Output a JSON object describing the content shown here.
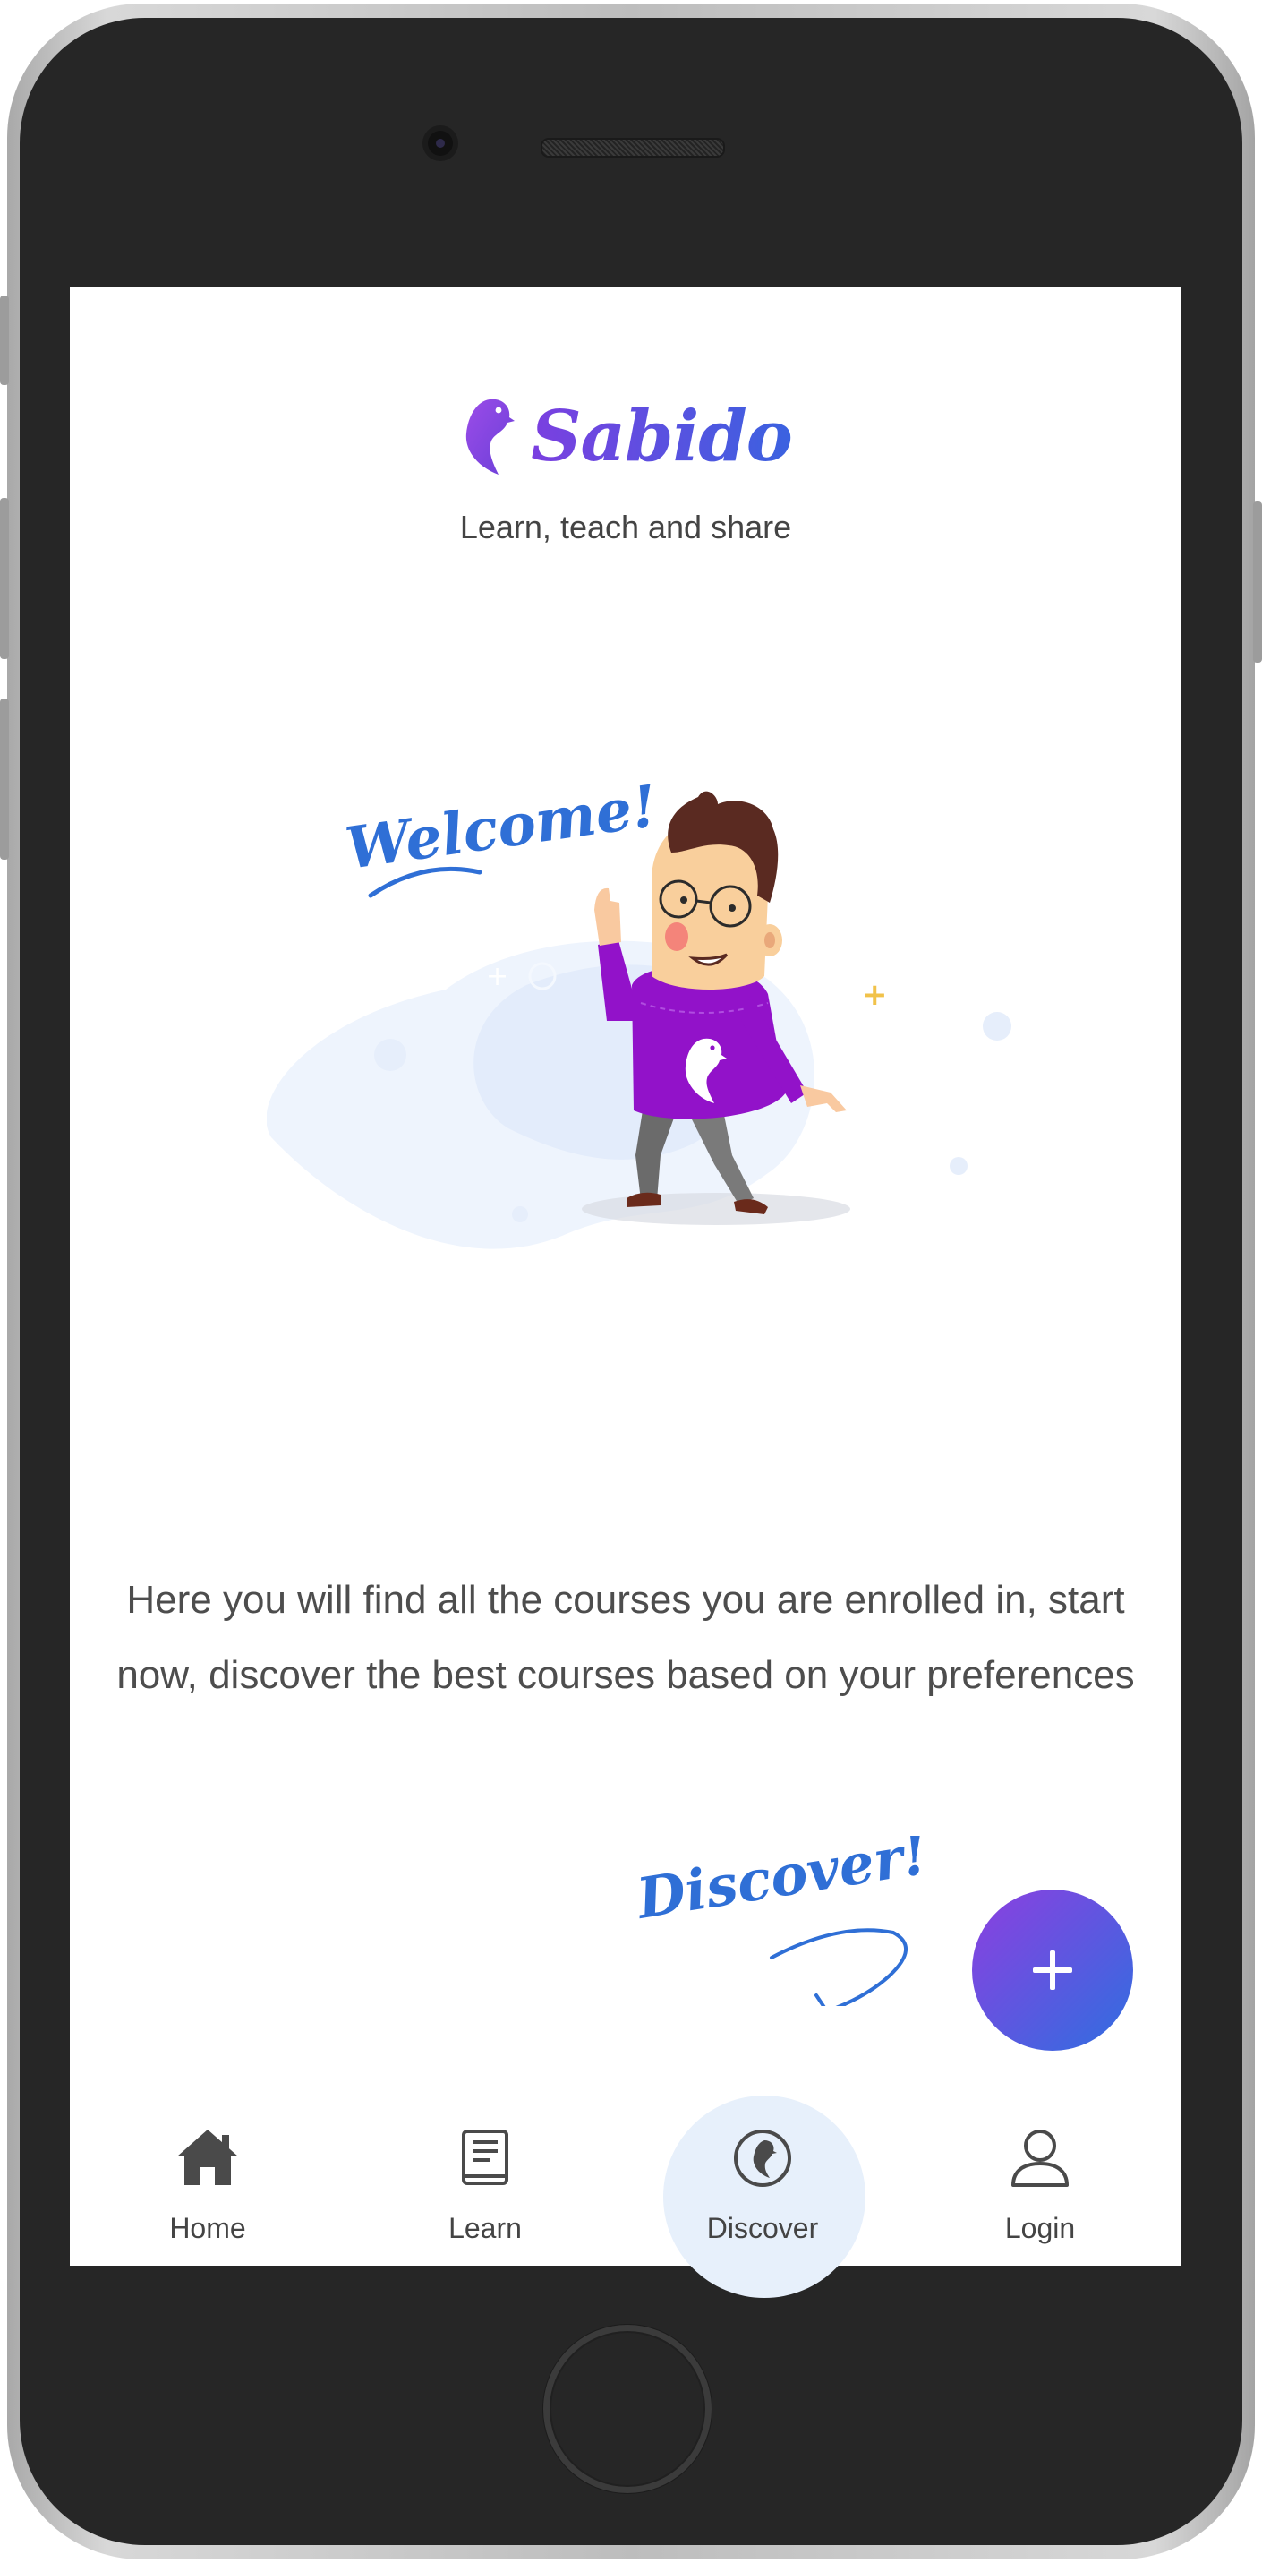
{
  "app": {
    "brand_name": "Sabido",
    "tagline": "Learn, teach and share"
  },
  "illustration": {
    "welcome_text": "Welcome!",
    "shirt_logo_icon": "sabido-bird-icon"
  },
  "main": {
    "message": "Here you will find all the courses you are enrolled in, start now, discover the best courses based on your preferences"
  },
  "hint": {
    "discover_text": "Discover!"
  },
  "fab": {
    "icon": "plus-icon"
  },
  "nav": {
    "items": [
      {
        "label": "Home",
        "icon": "home-icon",
        "active": false
      },
      {
        "label": "Learn",
        "icon": "book-icon",
        "active": false
      },
      {
        "label": "Discover",
        "icon": "sabido-bird-icon",
        "active": true
      },
      {
        "label": "Login",
        "icon": "user-icon",
        "active": false
      }
    ]
  },
  "colors": {
    "brand_purple": "#7b3fe0",
    "brand_blue": "#2f6ee0",
    "hint_blue": "#2f6fd6",
    "shirt_purple": "#9212c9",
    "nav_active_bg": "#e7f0fb",
    "text": "#4d4d4d"
  }
}
